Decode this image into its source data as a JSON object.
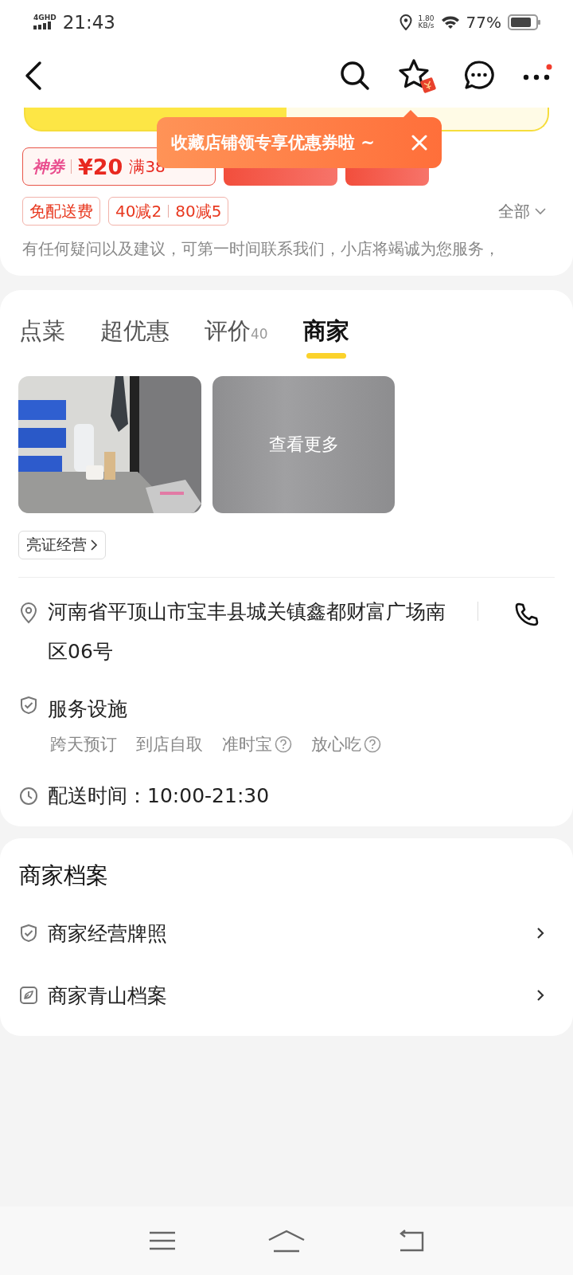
{
  "status_bar": {
    "network": "4GHD",
    "time": "21:43",
    "speed": "1.80",
    "speed_unit": "KB/s",
    "battery": "77%"
  },
  "tooltip": {
    "text": "收藏店铺领专享优惠券啦 ~"
  },
  "coupons": [
    {
      "kind": "god",
      "brand": "神券",
      "amount": "¥20",
      "condition": "满38"
    },
    {
      "kind": "red"
    },
    {
      "kind": "red"
    }
  ],
  "promo_tags": [
    {
      "texts": [
        "免配送费"
      ]
    },
    {
      "texts": [
        "40减2",
        "80减5"
      ]
    }
  ],
  "all_filter": "全部",
  "notice": "有任何疑问以及建议，可第一时间联系我们，小店将竭诚为您服务，",
  "tabs": [
    {
      "label": "点菜",
      "selected": false
    },
    {
      "label": "超优惠",
      "selected": false
    },
    {
      "label": "评价",
      "count": "40",
      "selected": false
    },
    {
      "label": "商家",
      "selected": true
    }
  ],
  "photos": [
    {
      "kind": "picture"
    },
    {
      "kind": "more",
      "label": "查看更多"
    }
  ],
  "license_badge": "亮证经营",
  "address": "河南省平顶山市宝丰县城关镇鑫都财富广场南区06号",
  "services": {
    "title": "服务设施",
    "items": [
      {
        "label": "跨天预订",
        "help": false
      },
      {
        "label": "到店自取",
        "help": false
      },
      {
        "label": "准时宝",
        "help": true
      },
      {
        "label": "放心吃",
        "help": true
      }
    ]
  },
  "delivery_time": "配送时间：10:00-21:30",
  "archive": {
    "title": "商家档案",
    "items": [
      {
        "kind": "shield",
        "label": "商家经营牌照"
      },
      {
        "kind": "leaf",
        "label": "商家青山档案"
      }
    ]
  }
}
